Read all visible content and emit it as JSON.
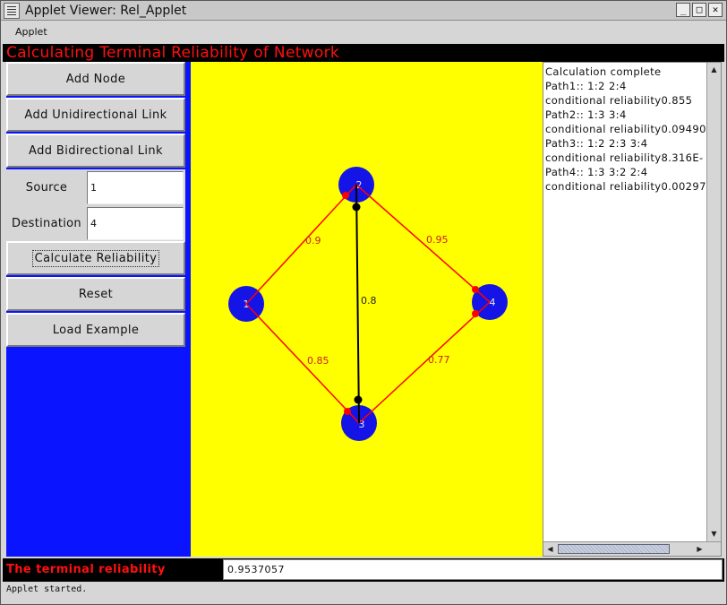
{
  "window": {
    "title": "Applet Viewer: Rel_Applet",
    "minimize": "_",
    "maximize": "□",
    "close": "✕"
  },
  "menu": {
    "applet": "Applet"
  },
  "banner": {
    "title": "Calculating Terminal Reliability of Network"
  },
  "controls": {
    "add_node": "Add Node",
    "add_uni": "Add Unidirectional Link",
    "add_bi": "Add Bidirectional Link",
    "source_label": "Source",
    "source_value": "1",
    "dest_label": "Destination",
    "dest_value": "4",
    "calculate": "Calculate Reliability",
    "reset": "Reset",
    "load_example": "Load Example"
  },
  "colors": {
    "canvas_bg": "#ffff00",
    "left_bg": "#0a14ff",
    "node_fill": "#1414e6",
    "link_red": "#ff0000",
    "link_black": "#000000",
    "banner_text": "#ff1010"
  },
  "graph": {
    "nodes": [
      {
        "id": "1",
        "label": "1"
      },
      {
        "id": "2",
        "label": "2"
      },
      {
        "id": "3",
        "label": "3"
      },
      {
        "id": "4",
        "label": "4"
      }
    ],
    "links": [
      {
        "from": "1",
        "to": "2",
        "label": "0.9",
        "kind": "bidirectional"
      },
      {
        "from": "2",
        "to": "4",
        "label": "0.95",
        "kind": "bidirectional"
      },
      {
        "from": "2",
        "to": "3",
        "label": "0.8",
        "kind": "unidirectional"
      },
      {
        "from": "1",
        "to": "3",
        "label": "0.85",
        "kind": "bidirectional"
      },
      {
        "from": "3",
        "to": "4",
        "label": "0.77",
        "kind": "bidirectional"
      }
    ]
  },
  "output": {
    "lines": [
      "Calculation complete",
      "Path1:: 1:2 2:4",
      "conditional reliability0.855",
      "Path2:: 1:3 3:4",
      "conditional reliability0.09490",
      "Path3:: 1:2 2:3 3:4",
      "conditional reliability8.316E-",
      "Path4:: 1:3 3:2 2:4",
      "conditional reliability0.00297"
    ]
  },
  "result": {
    "label": "The terminal reliability",
    "value": "0.9537057"
  },
  "status": {
    "text": "Applet started."
  }
}
